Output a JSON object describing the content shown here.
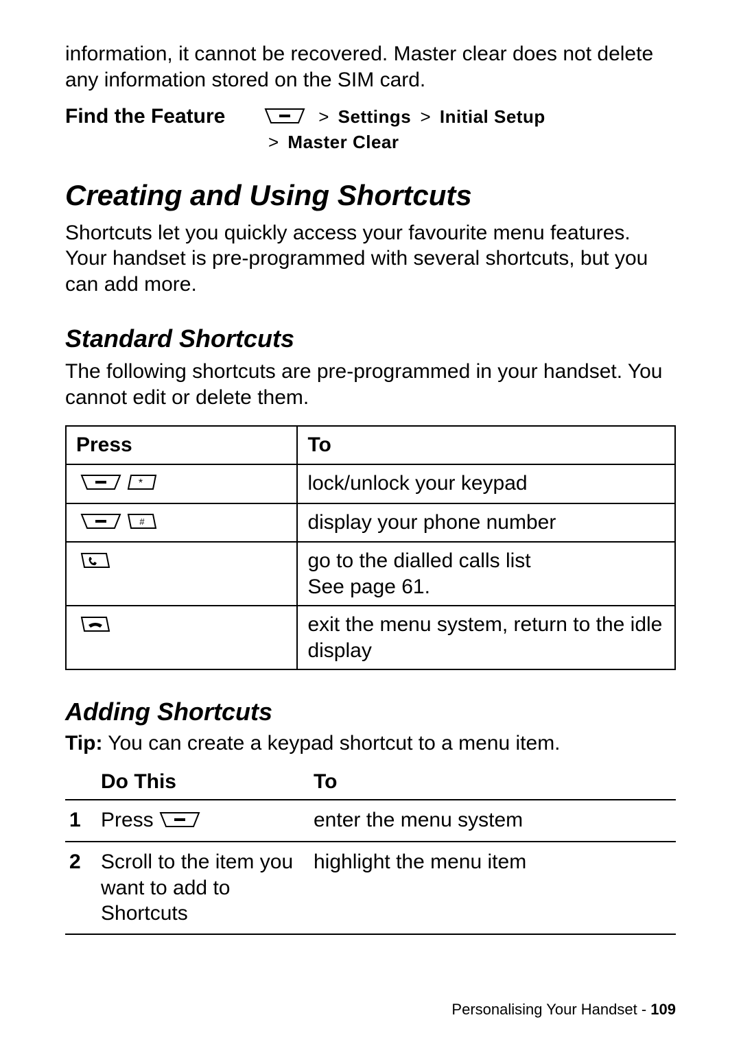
{
  "intro_text": "information, it cannot be recovered. Master clear does not delete any information stored on the SIM card.",
  "find_feature": {
    "label": "Find the Feature",
    "path_segments": [
      "Settings",
      "Initial Setup",
      "Master Clear"
    ]
  },
  "section_title": "Creating and Using Shortcuts",
  "section_intro": "Shortcuts let you quickly access your favourite menu features. Your handset is pre-programmed with several shortcuts, but you can add more.",
  "standard": {
    "heading": "Standard Shortcuts",
    "intro": "The following shortcuts are pre-programmed in your handset. You cannot edit or delete them.",
    "table": {
      "headers": [
        "Press",
        "To"
      ],
      "rows": [
        {
          "keys": [
            "menu",
            "star"
          ],
          "to": "lock/unlock your keypad"
        },
        {
          "keys": [
            "menu",
            "hash"
          ],
          "to": "display your phone number"
        },
        {
          "keys": [
            "send"
          ],
          "to": "go to the dialled calls list\nSee page 61."
        },
        {
          "keys": [
            "end"
          ],
          "to": "exit the menu system, return to the idle display"
        }
      ]
    }
  },
  "adding": {
    "heading": "Adding Shortcuts",
    "tip_label": "Tip:",
    "tip_text": "You can create a keypad shortcut to a menu item.",
    "table": {
      "headers": [
        "",
        "Do This",
        "To"
      ],
      "rows": [
        {
          "num": "1",
          "do_prefix": "Press ",
          "do_key": "menu",
          "do_suffix": "",
          "to": "enter the menu system"
        },
        {
          "num": "2",
          "do_text": "Scroll to the item you want to add to Shortcuts",
          "to": "highlight the menu item"
        }
      ]
    }
  },
  "footer": {
    "section": "Personalising Your Handset",
    "sep": " - ",
    "page": "109"
  }
}
